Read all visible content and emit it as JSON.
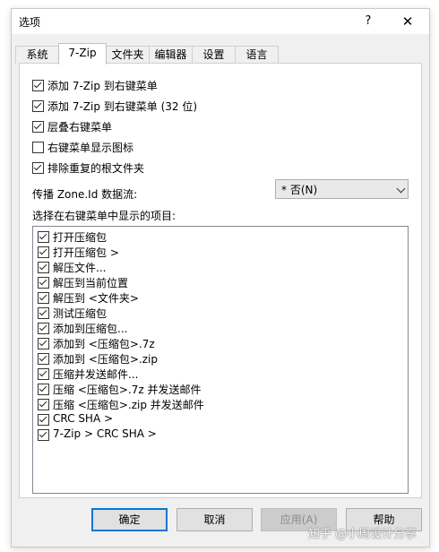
{
  "window": {
    "title": "选项",
    "help_label": "?",
    "close_label": "✕"
  },
  "tabs": [
    {
      "label": "系统"
    },
    {
      "label": "7-Zip",
      "active": true
    },
    {
      "label": "文件夹"
    },
    {
      "label": "编辑器"
    },
    {
      "label": "设置"
    },
    {
      "label": "语言"
    }
  ],
  "options": [
    {
      "label": "添加 7-Zip 到右键菜单",
      "checked": true
    },
    {
      "label": "添加 7-Zip 到右键菜单 (32 位)",
      "checked": true
    },
    {
      "label": "层叠右键菜单",
      "checked": true
    },
    {
      "label": "右键菜单显示图标",
      "checked": false
    },
    {
      "label": "排除重复的根文件夹",
      "checked": true
    }
  ],
  "zone": {
    "label": "传播 Zone.Id 数据流:",
    "selected": "* 否(N)"
  },
  "list_label": "选择在右键菜单中显示的项目:",
  "menu_items": [
    {
      "label": "打开压缩包",
      "checked": true
    },
    {
      "label": "打开压缩包 >",
      "checked": true
    },
    {
      "label": "解压文件...",
      "checked": true
    },
    {
      "label": "解压到当前位置",
      "checked": true
    },
    {
      "label": "解压到 <文件夹>",
      "checked": true
    },
    {
      "label": "测试压缩包",
      "checked": true
    },
    {
      "label": "添加到压缩包...",
      "checked": true
    },
    {
      "label": "添加到 <压缩包>.7z",
      "checked": true
    },
    {
      "label": "添加到 <压缩包>.zip",
      "checked": true
    },
    {
      "label": "压缩并发送邮件...",
      "checked": true
    },
    {
      "label": "压缩 <压缩包>.7z 并发送邮件",
      "checked": true
    },
    {
      "label": "压缩 <压缩包>.zip 并发送邮件",
      "checked": true
    },
    {
      "label": "CRC SHA >",
      "checked": true
    },
    {
      "label": "7-Zip > CRC SHA >",
      "checked": true
    }
  ],
  "buttons": {
    "ok": "确定",
    "cancel": "取消",
    "apply": "应用(A)",
    "help": "帮助"
  },
  "watermark": "知乎 @小周设计分享"
}
